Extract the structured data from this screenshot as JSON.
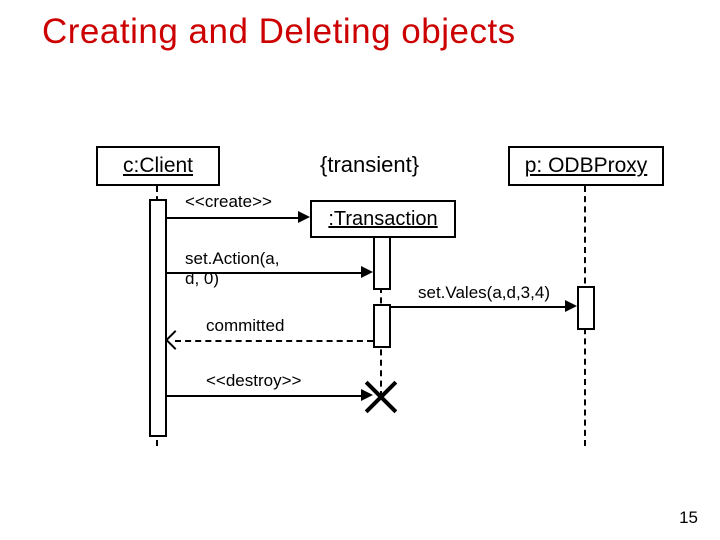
{
  "title": "Creating and Deleting objects",
  "participants": {
    "client": "c:Client",
    "constraint": "{transient}",
    "transaction": ":Transaction",
    "proxy": "p: ODBProxy"
  },
  "messages": {
    "create": "<<create>>",
    "setAction": "set.Action(a, d, 0)",
    "setVales": "set.Vales(a,d,3,4)",
    "committed": "committed",
    "destroy": "<<destroy>>"
  },
  "page": "15",
  "chart_data": {
    "type": "sequence_diagram",
    "participants": [
      {
        "id": "c",
        "label": "c:Client"
      },
      {
        "id": "t",
        "label": ":Transaction",
        "constraint": "{transient}",
        "created_by": "c",
        "destroyed": true
      },
      {
        "id": "p",
        "label": "p: ODBProxy"
      }
    ],
    "messages": [
      {
        "from": "c",
        "to": "t",
        "label": "<<create>>",
        "kind": "create"
      },
      {
        "from": "c",
        "to": "t",
        "label": "set.Action(a, d, 0)",
        "kind": "call"
      },
      {
        "from": "t",
        "to": "p",
        "label": "set.Vales(a,d,3,4)",
        "kind": "call"
      },
      {
        "from": "t",
        "to": "c",
        "label": "committed",
        "kind": "return"
      },
      {
        "from": "c",
        "to": "t",
        "label": "<<destroy>>",
        "kind": "destroy"
      }
    ]
  }
}
